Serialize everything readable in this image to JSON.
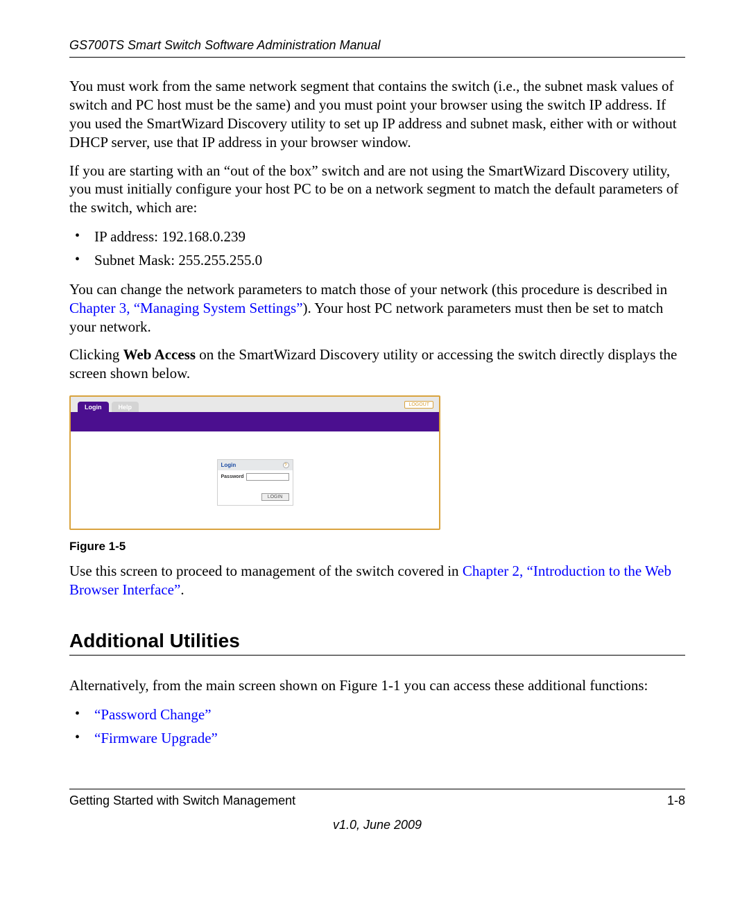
{
  "header": {
    "title": "GS700TS Smart Switch Software Administration Manual"
  },
  "paragraphs": {
    "p1": "You must work from the same network segment that contains the switch (i.e., the subnet mask values of switch and PC host must be the same) and you must point your browser using the switch IP address. If you used the SmartWizard Discovery utility to set up IP address and subnet mask, either with or without DHCP server, use that IP address in your browser window.",
    "p2": "If you are starting with an “out of the box” switch and are not using the SmartWizard Discovery utility, you must initially configure your host PC to be on a network segment to match the default parameters of the switch, which are:",
    "p3_pre": "You can change the network parameters to match those of your network (this procedure is described in ",
    "p3_link": "Chapter 3, “Managing System Settings”",
    "p3_post": "). Your host PC network parameters must then be set to match your network.",
    "p4_pre": "Clicking ",
    "p4_bold": "Web Access",
    "p4_post": " on the SmartWizard Discovery utility or accessing the switch directly displays the screen shown below.",
    "p5_pre": "Use this screen to proceed to management of the switch covered in ",
    "p5_link": "Chapter 2, “Introduction to the Web Browser Interface”",
    "p5_post": ".",
    "p6": "Alternatively, from the main screen shown on Figure 1-1 you can access these additional functions:"
  },
  "default_params": {
    "items": [
      "IP address: 192.168.0.239",
      "Subnet Mask: 255.255.255.0"
    ]
  },
  "figure": {
    "caption": "Figure 1-5",
    "ui": {
      "tab_login": "Login",
      "tab_help": "Help",
      "logout": "LOGOUT",
      "box_title": "Login",
      "password_label": "Password",
      "login_button": "LOGIN"
    }
  },
  "section": {
    "title": "Additional Utilities"
  },
  "utility_links": {
    "items": [
      "“Password Change”",
      "“Firmware Upgrade”"
    ]
  },
  "footer": {
    "left": "Getting Started with Switch Management",
    "right": "1-8",
    "version": "v1.0, June 2009"
  }
}
